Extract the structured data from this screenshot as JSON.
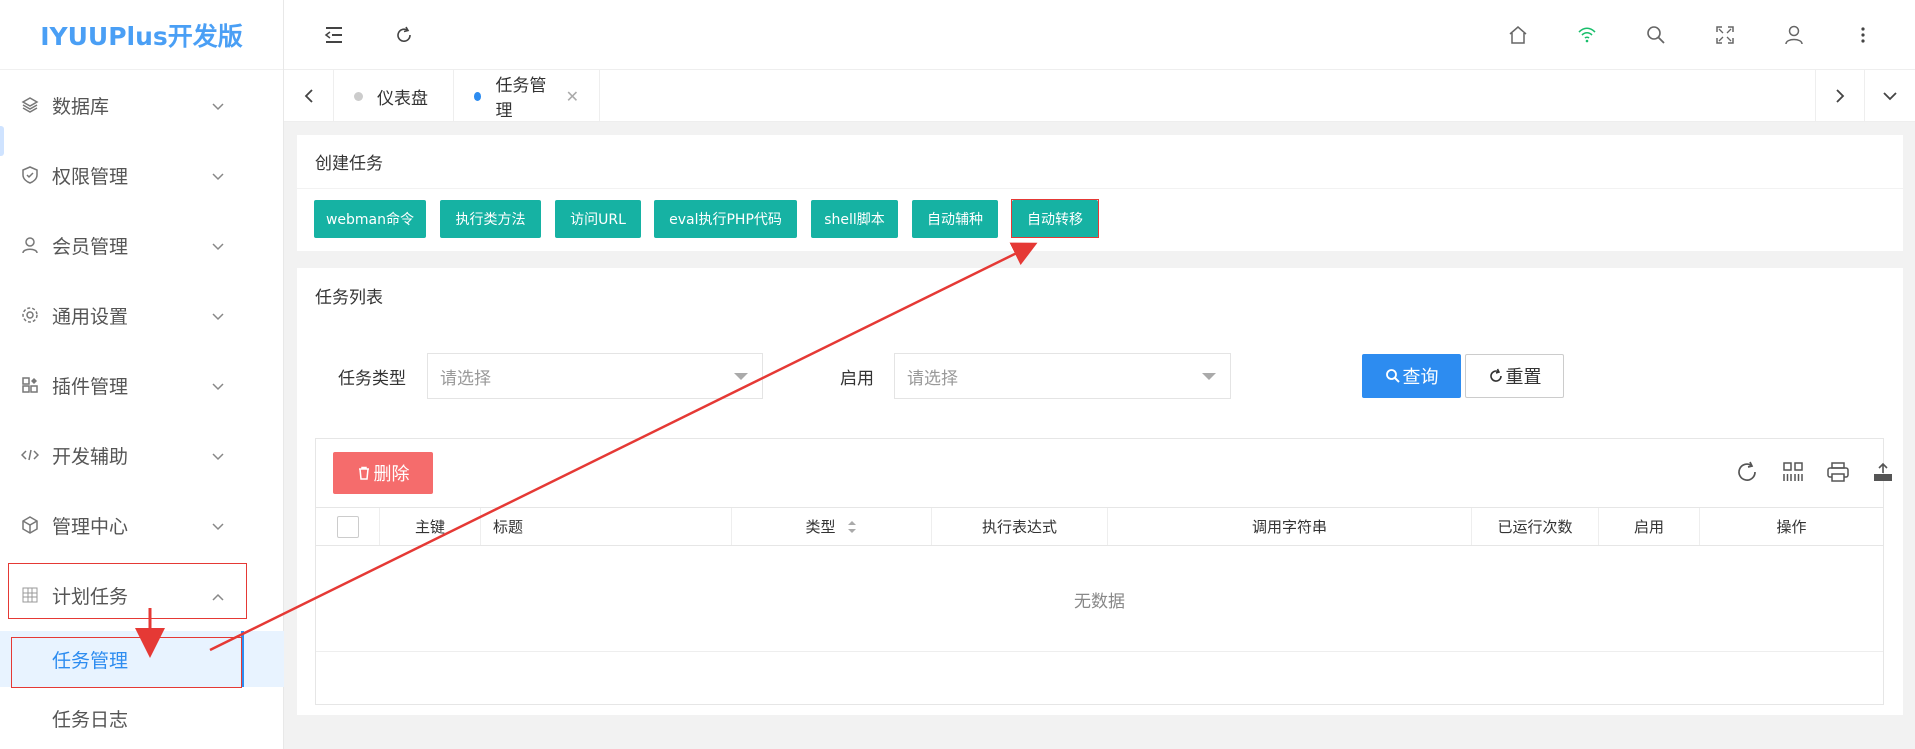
{
  "app": {
    "title": "IYUUPlus开发版"
  },
  "sidebar": {
    "items": [
      {
        "label": "数据库",
        "icon": "layers-icon"
      },
      {
        "label": "权限管理",
        "icon": "shield-icon"
      },
      {
        "label": "会员管理",
        "icon": "user-icon"
      },
      {
        "label": "通用设置",
        "icon": "gear-icon"
      },
      {
        "label": "插件管理",
        "icon": "plugin-icon"
      },
      {
        "label": "开发辅助",
        "icon": "code-icon"
      },
      {
        "label": "管理中心",
        "icon": "cube-icon"
      },
      {
        "label": "计划任务",
        "icon": "grid-icon"
      }
    ],
    "sub_items": [
      {
        "label": "任务管理",
        "active": true
      },
      {
        "label": "任务日志",
        "active": false
      }
    ]
  },
  "topbar": {
    "icons": [
      "menu-fold-icon",
      "refresh-icon",
      "home-icon",
      "wifi-icon",
      "search-icon",
      "fullscreen-icon",
      "user-icon",
      "more-icon"
    ],
    "wifi_color": "#19be6b"
  },
  "tabs": [
    {
      "label": "仪表盘",
      "active": false
    },
    {
      "label": "任务管理",
      "active": true
    }
  ],
  "create": {
    "title": "创建任务",
    "buttons": [
      "webman命令",
      "执行类方法",
      "访问URL",
      "eval执行PHP代码",
      "shell脚本",
      "自动辅种",
      "自动转移"
    ]
  },
  "list": {
    "title": "任务列表",
    "filters": {
      "type_label": "任务类型",
      "type_placeholder": "请选择",
      "enabled_label": "启用",
      "enabled_placeholder": "请选择"
    },
    "query_label": "查询",
    "reset_label": "重置",
    "delete_label": "删除",
    "columns": [
      "主键",
      "标题",
      "类型",
      "执行表达式",
      "调用字符串",
      "已运行次数",
      "启用",
      "操作"
    ],
    "empty_text": "无数据"
  },
  "colors": {
    "accent": "#2d8cf0",
    "teal": "#16b2a3",
    "danger": "#f56c6c",
    "annotation": "#e53935"
  }
}
